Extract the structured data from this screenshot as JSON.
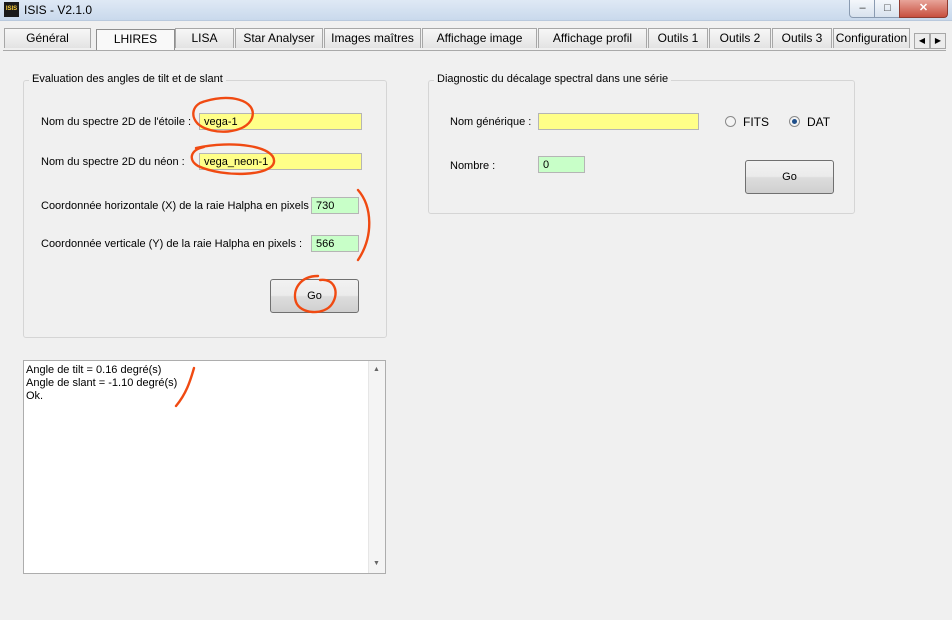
{
  "window": {
    "title": "ISIS - V2.1.0",
    "icon": "isis-app-icon",
    "icon_text": "ISIS"
  },
  "tabs": [
    "Général",
    "LHIRES",
    "LISA",
    "Star Analyser",
    "Images maîtres",
    "Affichage image",
    "Affichage profil",
    "Outils 1",
    "Outils 2",
    "Outils 3",
    "Configuration"
  ],
  "active_tab": "LHIRES",
  "tilt_group": {
    "legend": "Evaluation des angles de tilt et de slant",
    "star_label": "Nom du spectre 2D  de l'étoile :",
    "star_value": "vega-1",
    "neon_label": "Nom du spectre 2D  du néon :",
    "neon_value": "vega_neon-1",
    "x_label": "Coordonnée horizontale (X) de la raie Halpha en pixels :",
    "x_value": "730",
    "y_label": "Coordonnée verticale (Y) de la raie Halpha en pixels :",
    "y_value": "566",
    "go_label": "Go"
  },
  "output_lines": [
    "Angle de tilt = 0.16 degré(s)",
    "Angle de slant = -1.10 degré(s)",
    "Ok."
  ],
  "diag_group": {
    "legend": "Diagnostic du décalage spectral dans une série",
    "generic_label": "Nom générique :",
    "generic_value": "",
    "fits_label": "FITS",
    "dat_label": "DAT",
    "selected_format": "DAT",
    "count_label": "Nombre :",
    "count_value": "0",
    "go_label": "Go"
  },
  "colors": {
    "required_field": "#ffff88",
    "numeric_field": "#c8ffc8",
    "annotation": "#f04a12"
  }
}
